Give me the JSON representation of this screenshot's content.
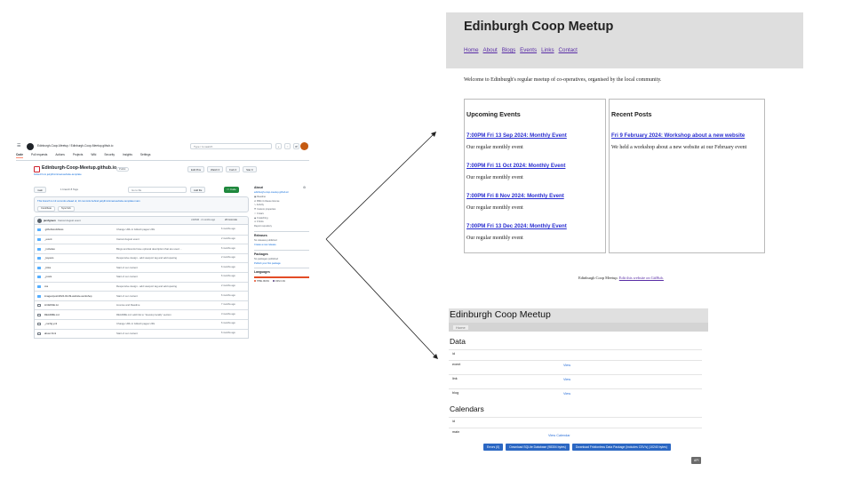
{
  "github": {
    "breadcrumb": "Edinburgh-Coop-Meetup / Edinburgh-Coop-Meetup.github.io",
    "search_placeholder": "Type / to search",
    "tabs": [
      "Code",
      "Pull requests",
      "Actions",
      "Projects",
      "Wiki",
      "Security",
      "Insights",
      "Settings"
    ],
    "repo_name": "Edinburgh-Coop-Meetup.github.io",
    "visibility": "Public",
    "forked_from": "forked from jekyll/minimal-website-template",
    "repo_buttons": [
      "Edit Pins",
      "Watch 0",
      "Fork 0",
      "Star 0"
    ],
    "branch": "main",
    "branch_meta": "1 branch  8 Tags",
    "goto_file": "Go to file",
    "add_file": "Add file",
    "code_button": "<> Code",
    "ahead_text": "This branch is 13 commits ahead of, 10 commits behind jekyll/minimal-website-template:main",
    "ahead_buttons": [
      "Contribute",
      "Sync fork"
    ],
    "commit_user": "jarofgreen",
    "commit_msg": "Cancel August event",
    "commit_hash": "c4fc5d6 · 2 months ago",
    "commit_count": "26 Commits",
    "files": [
      {
        "name": ".github/workflows",
        "type": "dir",
        "msg": "Change URL in GitHub pages URL",
        "age": "6 months ago"
      },
      {
        "name": "_event",
        "type": "dir",
        "msg": "Cancel August event",
        "age": "2 months ago"
      },
      {
        "name": "_includes",
        "type": "dir",
        "msg": "Blogs and Events have optional description that are used ...",
        "age": "6 months ago"
      },
      {
        "name": "_layouts",
        "type": "dir",
        "msg": "Responsive design - add viewport tag and add spacing",
        "age": "2 months ago"
      },
      {
        "name": "_links",
        "type": "dir",
        "msg": "Start of our content",
        "age": "6 months ago"
      },
      {
        "name": "_posts",
        "type": "dir",
        "msg": "Start of our content",
        "age": "6 months ago"
      },
      {
        "name": "css",
        "type": "dir",
        "msg": "Responsive design - add viewport tag and add spacing",
        "age": "2 months ago"
      },
      {
        "name": "images/post/2024-02-09-website-workshop",
        "type": "dir",
        "msg": "Start of our content",
        "age": "6 months ago"
      },
      {
        "name": "LICENSE.txt",
        "type": "file",
        "msg": "License and Readme",
        "age": "7 months ago"
      },
      {
        "name": "README.md",
        "type": "file",
        "msg": "README.md: add link to \"develop locally\" section",
        "age": "3 months ago"
      },
      {
        "name": "_config.yml",
        "type": "file",
        "msg": "Change URL in GitHub pages URL",
        "age": "6 months ago"
      },
      {
        "name": "about.html",
        "type": "file",
        "msg": "Start of our content",
        "age": "6 months ago"
      }
    ],
    "about": {
      "heading": "About",
      "link": "edinburgh-coop-meetup.github.io/",
      "items": [
        "Readme",
        "BSD-3-Clause license",
        "Activity",
        "Custom properties",
        "0 stars",
        "0 watching",
        "0 forks"
      ],
      "report": "Report repository",
      "releases_h": "Releases",
      "releases_text": "No releases published",
      "releases_link": "Create a new release",
      "packages_h": "Packages",
      "packages_text": "No packages published",
      "packages_link": "Publish your first package",
      "languages_h": "Languages",
      "languages": [
        {
          "name": "HTML 99.9%",
          "pct": 99.9,
          "color": "#e34c26"
        },
        {
          "name": "CSS 0.1%",
          "pct": 0.1,
          "color": "#563d7c"
        }
      ]
    }
  },
  "site": {
    "title": "Edinburgh Coop Meetup",
    "nav": [
      "Home",
      "About",
      "Blogs",
      "Events",
      "Links",
      "Contact"
    ],
    "welcome": "Welcome to Edinburgh's regular meetup of co-operatives, organised by the local community.",
    "events_heading": "Upcoming Events",
    "events": [
      {
        "title": "7:00PM Fri 13 Sep 2024: Monthly Event",
        "desc": "Our regular monthly event"
      },
      {
        "title": "7:00PM Fri 11 Oct 2024: Monthly Event",
        "desc": "Our regular monthly event"
      },
      {
        "title": "7:00PM Fri 8 Nov 2024: Monthly Event",
        "desc": "Our regular monthly event"
      },
      {
        "title": "7:00PM Fri 13 Dec 2024: Monthly Event",
        "desc": "Our regular monthly event"
      }
    ],
    "posts_heading": "Recent Posts",
    "posts": [
      {
        "title": "Fri 9 February 2024: Workshop about a new website",
        "desc": "We held a workshop about a new website at our February event"
      }
    ],
    "footer_text": "Edinburgh Coop Meetup.",
    "footer_link": "Edit this website on GitHub."
  },
  "datasette": {
    "title": "Edinburgh Coop Meetup",
    "nav": "Home",
    "data_heading": "Data",
    "data_header_key": "id",
    "data_rows": [
      {
        "key": "event",
        "link": "View"
      },
      {
        "key": "link",
        "link": "View"
      },
      {
        "key": "blog",
        "link": "View"
      }
    ],
    "calendars_heading": "Calendars",
    "calendars_header_key": "id",
    "calendar_rows": [
      {
        "key": "main",
        "link": "View Calendar"
      }
    ],
    "buttons": [
      "Errors (0)",
      "Download SQLite Database (98304 bytes)",
      "Download Frictionless Data Package (includes CSV's) (10240 bytes)"
    ],
    "api_button": "API"
  }
}
